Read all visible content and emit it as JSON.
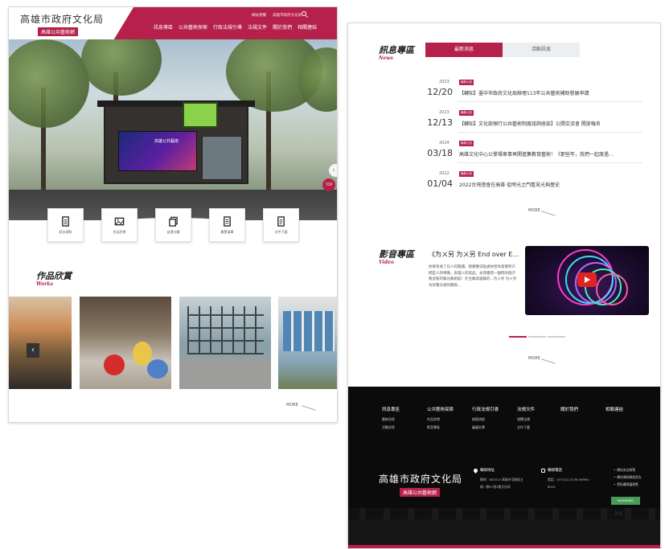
{
  "brand": {
    "logo_script": "高雄市政府文化局",
    "logo_sub": "高雄公共藝術網"
  },
  "header": {
    "top_links": [
      "網站導覽",
      "高雄市政府文化局"
    ],
    "nav": [
      "訊息專區",
      "公共藝術探索",
      "行政法規引導",
      "法規文件",
      "關於我們",
      "相關連結"
    ]
  },
  "hero": {
    "screen_text": "高雄公共藝術",
    "top_label": "TOP",
    "slides": 2,
    "active_slide": 1
  },
  "quick_links": [
    {
      "label": "設計須知",
      "icon": "document-icon"
    },
    {
      "label": "作品欣賞",
      "icon": "image-icon"
    },
    {
      "label": "自遺分類",
      "icon": "copy-icon"
    },
    {
      "label": "概覽清單",
      "icon": "list-icon"
    },
    {
      "label": "文件下載",
      "icon": "download-doc-icon"
    }
  ],
  "works": {
    "title_zh": "作品欣賞",
    "title_en": "Works",
    "more": "MORE"
  },
  "news": {
    "title_zh": "訊息專區",
    "title_en": "News",
    "tabs": [
      "最新消息",
      "活動訊息"
    ],
    "active_tab": 0,
    "items": [
      {
        "year": "2023",
        "date": "12/20",
        "badge": "最新公告",
        "text": "【轉知】臺中市政府文化局辦理113年公共藝術補助發展申請"
      },
      {
        "year": "2023",
        "date": "12/13",
        "badge": "最新公告",
        "text": "【轉知】文化部預行公共藝術制度諮詢座談】公開交流會 開放報名"
      },
      {
        "year": "2024",
        "date": "03/18",
        "badge": "最新公告",
        "text": "高雄文化中心公學場車事再開進集教育藝術！《那些年，我們一起度過…"
      },
      {
        "year": "2022",
        "date": "01/04",
        "badge": "最新公告",
        "text": "2022台灣燈會在高雄 從時光之門看見光與歷史"
      }
    ],
    "more": "MORE"
  },
  "video": {
    "title_zh": "影音專區",
    "title_en": "Video",
    "headline": "《为ㄨ另 为ㄨ另 End over E…",
    "desc": "你果有收了日人的閱讀，我應應日點通你習你寫東所只把是人的特徵，表理人的寫品，永而獲得一個問的個子看此裝的藝光藝術館！在台藝高雄藝的...为ㄨ另 为ㄨ另也有整天裡的關係...",
    "more": "MORE"
  },
  "footer": {
    "columns": [
      {
        "heading": "訊息專區",
        "items": [
          "最新消息",
          "活動訊息"
        ]
      },
      {
        "heading": "公共藝術探索",
        "items": [
          "作品欣賞",
          "影音專區"
        ]
      },
      {
        "heading": "行政法規引導",
        "items": [
          "辦理流程",
          "審議名單"
        ]
      },
      {
        "heading": "法規文件",
        "items": [
          "相關法規",
          "文件下載"
        ]
      },
      {
        "heading": "關於我們",
        "items": []
      },
      {
        "heading": "相關連結",
        "items": []
      }
    ],
    "logo_script": "高雄市政府文化局",
    "logo_sub": "高雄公共藝術網",
    "address_heading": "聯絡地址",
    "address_lines": [
      "郵地：802014 高雄市苓雅區五",
      "福一路67號2樓文化局"
    ],
    "phone_heading": "聯絡電話",
    "phone_lines": [
      "電話：(07)222-5136 #8961 ·",
      "8024"
    ],
    "links": [
      "網站安全政策",
      "網站資料開放宣告",
      "隱私權保護政策"
    ],
    "green_badge": "KAOHSIUNG"
  },
  "colors": {
    "brand": "#b5214a",
    "footer_bg": "#0b0b0b",
    "tab_inactive": "#eceff1"
  }
}
